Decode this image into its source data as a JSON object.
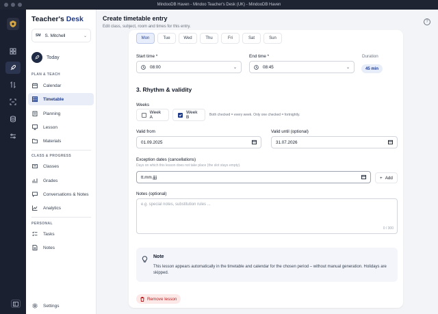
{
  "window": {
    "title": "MindooDB Haven - Mindoo Teacher's Desk (UK) - MindooDB Haven"
  },
  "sidebar": {
    "brand_part1": "Teacher's ",
    "brand_part2": "Desk",
    "user_badge": "SM",
    "user_name": "S. Mitchell",
    "today": "Today",
    "sections": {
      "plan": "PLAN & TEACH",
      "progress": "CLASS & PROGRESS",
      "personal": "PERSONAL"
    },
    "plan_items": [
      "Calendar",
      "Timetable",
      "Planning",
      "Lesson",
      "Materials"
    ],
    "progress_items": [
      "Classes",
      "Grades",
      "Conversations & Notes",
      "Analytics"
    ],
    "personal_items": [
      "Tasks",
      "Notes"
    ],
    "settings": "Settings",
    "active_item": "Timetable"
  },
  "header": {
    "title": "Create timetable entry",
    "subtitle": "Edit class, subject, room and times for this entry.",
    "help": "?"
  },
  "form": {
    "days": [
      "Mon",
      "Tue",
      "Wed",
      "Thu",
      "Fri",
      "Sat",
      "Sun"
    ],
    "selected_day": "Mon",
    "start_time_label": "Start time *",
    "start_time_value": "08:00",
    "end_time_label": "End time *",
    "end_time_value": "08:45",
    "duration_label": "Duration",
    "duration_value": "45 min",
    "section_title": "3. Rhythm & validity",
    "weeks_label": "Weeks",
    "week_a": "Week A",
    "week_a_checked": false,
    "week_b": "Week B",
    "week_b_checked": true,
    "weeks_hint": "Both checked = every week. Only one checked = fortnightly.",
    "valid_from_label": "Valid from",
    "valid_from_value": "01.09.2025",
    "valid_until_label": "Valid until (optional)",
    "valid_until_value": "31.07.2026",
    "exception_label": "Exception dates (cancellations)",
    "exception_hint": "Days on which this lesson does not take place (the slot stays empty).",
    "exception_placeholder": "tt.mm.jjjj",
    "add_label": "Add",
    "notes_label": "Notes (optional)",
    "notes_placeholder": "e.g. special notes, substitution rules ...",
    "notes_count": "0 / 300",
    "note_title": "Note",
    "note_text": "This lesson appears automatically in the timetable and calendar for the chosen period – without manual generation. Holidays are skipped.",
    "remove_label": "Remove lesson"
  },
  "colors": {
    "accent": "#1e3a8a",
    "danger": "#b91c1c",
    "rail": "#1b2030"
  }
}
